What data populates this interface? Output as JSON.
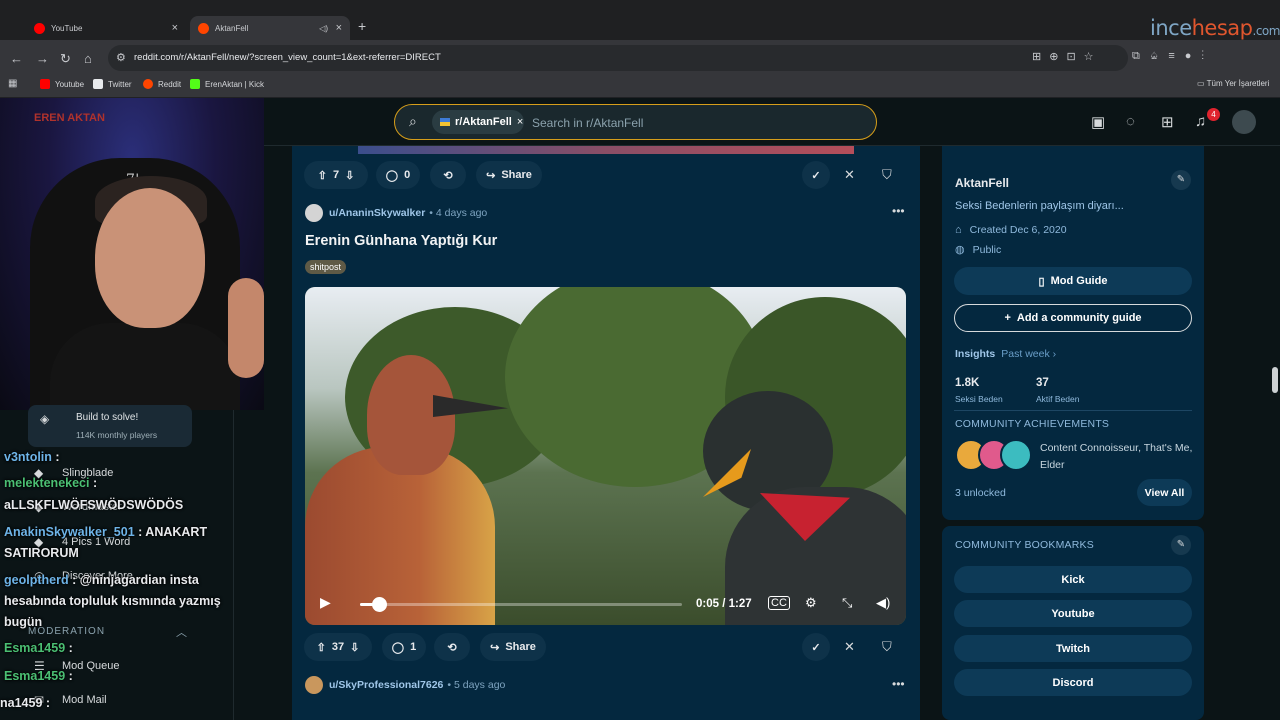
{
  "browser": {
    "tabs": [
      {
        "title": "YouTube",
        "color": "#ff0000"
      },
      {
        "title": "AktanFell",
        "color": "#ff4500"
      }
    ],
    "url": "reddit.com/r/AktanFell/new/?screen_view_count=1&ext-referrer=DIRECT",
    "bookmarks": [
      {
        "label": "Youtube",
        "color": "#ff0000"
      },
      {
        "label": "Twitter",
        "color": "#e8eaed"
      },
      {
        "label": "Reddit",
        "color": "#ff4500"
      },
      {
        "label": "ErenAktan | Kick",
        "color": "#53fc18"
      }
    ],
    "all_bookmarks": "Tüm Yer İşaretleri",
    "watermark_a": "ince",
    "watermark_b": "hesap",
    "watermark_c": ".com"
  },
  "header": {
    "search_chip": "r/AktanFell",
    "search_placeholder": "Search in r/AktanFell",
    "notifications_count": "4"
  },
  "overlay": {
    "streamer_name": "EREN AKTAN",
    "chair_logo": "7|o",
    "puzzle_card": {
      "title": "Build to solve!",
      "subtitle": "114K monthly players"
    },
    "nav_items": [
      "Slingblade",
      "Wordmaster",
      "4 Pics 1 Word",
      "Discover More",
      "Mod Queue",
      "Mod Mail"
    ],
    "moderation_label": "MODERATION",
    "chat": [
      {
        "user": "v3ntolin",
        "text": ":"
      },
      {
        "user": "melektenekeci",
        "text": ":"
      },
      {
        "user": "",
        "text": "aLLSKFLWÖFSWÖDSWÖDÖS"
      },
      {
        "user": "AnakinSkywalker_501",
        "text": ": ANAKART"
      },
      {
        "user": "",
        "text": "SATIRORUM"
      },
      {
        "user": "geolptherd",
        "text": ": @ninjagardian insta"
      },
      {
        "user": "",
        "text": "hesabında topluluk kısmında yazmış"
      },
      {
        "user": "",
        "text": "bugün"
      },
      {
        "user": "Esma1459",
        "text": ":"
      },
      {
        "user": "Esma1459",
        "text": ":"
      },
      {
        "user": "na1459",
        "text": ":"
      }
    ]
  },
  "feed": {
    "top_actions": {
      "votes": "7",
      "comments": "0",
      "share": "Share"
    },
    "post": {
      "user": "u/AnaninSkywalker",
      "age": "• 4 days ago",
      "title": "Erenin Günhana Yaptığı Kur",
      "flair": "shitpost",
      "video_time": "0:05 / 1:27",
      "video_progress": 0.06,
      "votes": "37",
      "comments": "1",
      "share": "Share"
    },
    "next_post": {
      "user": "u/SkyProfessional7626",
      "age": "• 5 days ago"
    }
  },
  "sidebar": {
    "community": "AktanFell",
    "description": "Seksi Bedenlerin paylaşım diyarı...",
    "created": "Created Dec 6, 2020",
    "visibility": "Public",
    "mod_guide": "Mod Guide",
    "add_guide": "Add a community guide",
    "insights_label": "Insights",
    "insights_period": "Past week ›",
    "stats": [
      {
        "value": "1.8K",
        "label": "Seksi Beden"
      },
      {
        "value": "37",
        "label": "Aktif Beden"
      }
    ],
    "achievements_title": "COMMUNITY ACHIEVEMENTS",
    "achievements_text": "Content Connoisseur, That's Me, Elder",
    "unlocked": "3 unlocked",
    "view_all": "View All",
    "bookmarks_title": "COMMUNITY BOOKMARKS",
    "bookmarks": [
      "Kick",
      "Youtube",
      "Twitch",
      "Discord"
    ]
  }
}
